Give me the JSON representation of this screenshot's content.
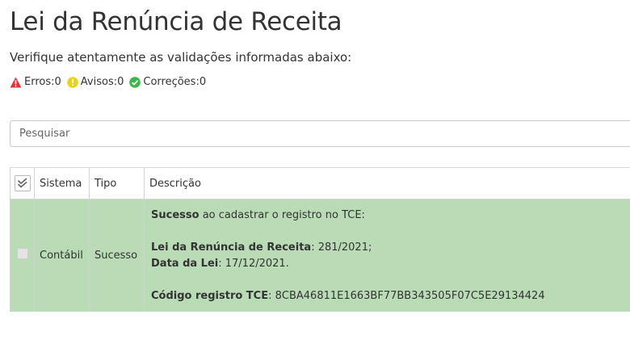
{
  "page": {
    "title": "Lei da Renúncia de Receita",
    "subtitle": "Verifique atentamente as validações informadas abaixo:"
  },
  "counters": {
    "errors": "Erros:0",
    "warnings": "Avisos:0",
    "corrections": "Correções:0"
  },
  "search": {
    "placeholder": "Pesquisar"
  },
  "table": {
    "headers": {
      "sistema": "Sistema",
      "tipo": "Tipo",
      "descricao": "Descrição"
    },
    "rows": [
      {
        "sistema": "Contábil",
        "tipo": "Sucesso",
        "desc": {
          "l1_bold": "Sucesso",
          "l1_text": " ao cadastrar o registro no TCE:",
          "l2_bold": "Lei da Renúncia de Receita",
          "l2_text": ": 281/2021;",
          "l3_bold": "Data da Lei",
          "l3_text": ": 17/12/2021.",
          "l4_bold": "Código registro TCE",
          "l4_text": ": 8CBA46811E1663BF77BB343505F07C5E29134424"
        }
      }
    ]
  },
  "colors": {
    "error": "#e0353a",
    "warning": "#e8d21c",
    "correction": "#3cb54a",
    "success_row": "#b9dbb6"
  }
}
